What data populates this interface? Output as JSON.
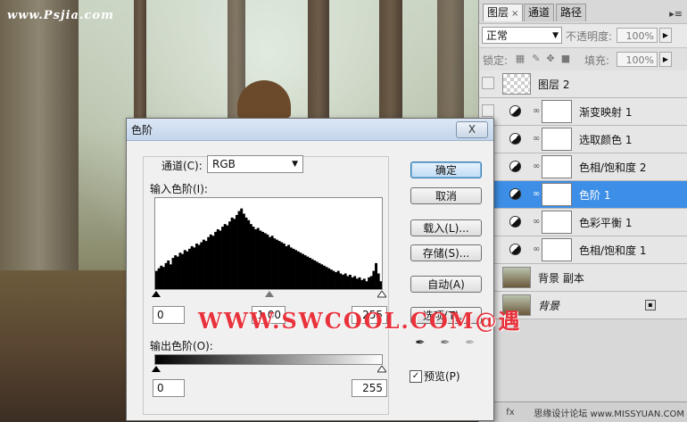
{
  "watermarks": {
    "top_left": "www.Psjia.com",
    "center": "WWW.SWCOOL.COM@遇",
    "bottom_right": "思缘设计论坛 www.MISSYUAN.COM"
  },
  "layers_panel": {
    "tabs": [
      {
        "label": "图层"
      },
      {
        "label": "通道"
      },
      {
        "label": "路径"
      }
    ],
    "tab_close": "×",
    "menu_glyph": "▸≡",
    "blend_mode": "正常",
    "opacity_label": "不透明度:",
    "opacity_value": "100%",
    "lock_label": "锁定:",
    "fill_label": "填充:",
    "fill_value": "100%",
    "layers": [
      {
        "name": "图层 2",
        "kind": "pixel"
      },
      {
        "name": "渐变映射 1",
        "kind": "adjustment"
      },
      {
        "name": "选取颜色 1",
        "kind": "adjustment"
      },
      {
        "name": "色相/饱和度 2",
        "kind": "adjustment"
      },
      {
        "name": "色阶 1",
        "kind": "adjustment",
        "selected": true
      },
      {
        "name": "色彩平衡 1",
        "kind": "adjustment"
      },
      {
        "name": "色相/饱和度 1",
        "kind": "adjustment"
      },
      {
        "name": "背景 副本",
        "kind": "photo"
      },
      {
        "name": "背景",
        "kind": "photo",
        "locked": true
      }
    ],
    "selected_color": "#3d8ee6"
  },
  "levels_dialog": {
    "title": "色阶",
    "close_glyph": "X",
    "channel_label": "通道(C):",
    "channel_value": "RGB",
    "input_label": "输入色阶(I):",
    "input_black": "0",
    "input_gamma": "1.00",
    "input_white": "255",
    "output_label": "输出色阶(O):",
    "output_black": "0",
    "output_white": "255",
    "buttons": {
      "ok": "确定",
      "cancel": "取消",
      "load": "载入(L)...",
      "save": "存储(S)...",
      "auto": "自动(A)",
      "options": "选项(T)..."
    },
    "preview_label": "预览(P)",
    "preview_checked": true,
    "histogram": [
      14,
      16,
      18,
      17,
      20,
      22,
      19,
      24,
      26,
      25,
      28,
      27,
      30,
      29,
      31,
      33,
      32,
      35,
      34,
      36,
      38,
      37,
      40,
      42,
      41,
      44,
      46,
      45,
      48,
      50,
      49,
      52,
      55,
      54,
      57,
      60,
      62,
      58,
      55,
      53,
      50,
      48,
      46,
      47,
      45,
      44,
      43,
      42,
      40,
      41,
      39,
      38,
      37,
      36,
      35,
      33,
      34,
      32,
      31,
      30,
      29,
      28,
      27,
      26,
      25,
      24,
      23,
      22,
      21,
      20,
      19,
      18,
      17,
      16,
      15,
      14,
      13,
      14,
      12,
      11,
      12,
      10,
      11,
      9,
      10,
      8,
      9,
      7,
      8,
      6,
      9,
      10,
      14,
      20,
      12,
      6
    ]
  }
}
